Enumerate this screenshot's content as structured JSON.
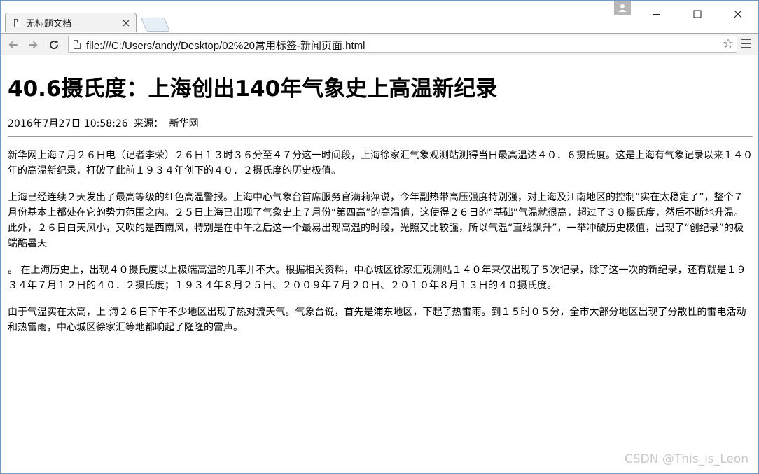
{
  "browser": {
    "tab_title": "无标题文档",
    "url": "file:///C:/Users/andy/Desktop/02%20常用标签-新闻页面.html"
  },
  "article": {
    "title": "40.6摄氏度：上海创出140年气象史上高温新纪录",
    "date": "2016年7月27日 10:58:26",
    "source_label": "来源：",
    "source": "新华网",
    "paragraphs": [
      "新华网上海７月２６日电（记者李荣）２６日１３时３６分至４７分这一时间段，上海徐家汇气象观测站测得当日最高温达４０．６摄氏度。这是上海有气象记录以来１４０年的高温新纪录，打破了此前１９３４年创下的４０．２摄氏度的历史极值。",
      "上海已经连续２天发出了最高等级的红色高温警报。上海中心气象台首席服务官满莉萍说，今年副热带高压强度特别强，对上海及江南地区的控制“实在太稳定了”，整个７月份基本上都处在它的势力范围之内。２５日上海已出现了气象史上７月份“第四高”的高温值，这使得２６日的“基础”气温就很高，超过了３０摄氏度，然后不断地升温。此外，２６日白天风小，又吹的是西南风，特别是在中午之后这一个最易出现高温的时段，光照又比较强，所以气温“直线飙升”，一举冲破历史极值，出现了“创纪录”的极端酷暑天",
      "。 在上海历史上，出现４０摄氏度以上极端高温的几率并不大。根据相关资料，中心城区徐家汇观测站１４０年来仅出现了５次记录，除了这一次的新纪录，还有就是１９３４年７月１２日的４０．２摄氏度；１９３４年８月２５日、２００９年７月２０日、２０１０年８月１３日的４０摄氏度。",
      "由于气温实在太高，上 海２６日下午不少地区出现了热对流天气。气象台说，首先是浦东地区，下起了热雷雨。到１５时０５分，全市大部分地区出现了分散性的雷电活动和热雷雨，中心城区徐家汇等地都响起了隆隆的雷声。"
    ]
  },
  "watermark": "CSDN @This_is_Leon"
}
